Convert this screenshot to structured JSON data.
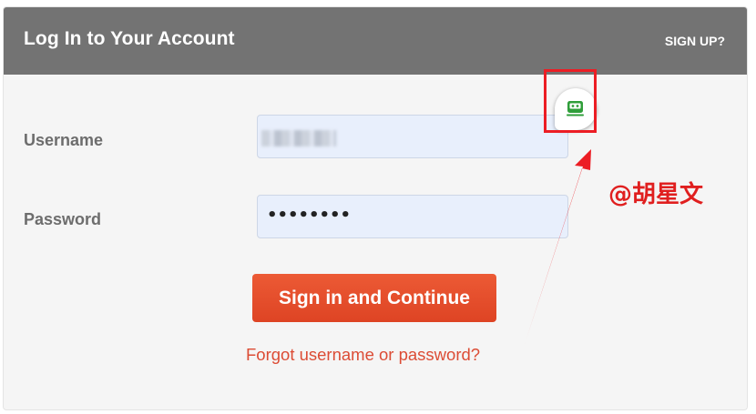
{
  "header": {
    "title": "Log In to Your Account",
    "signup_label": "SIGN UP?"
  },
  "form": {
    "username_label": "Username",
    "password_label": "Password",
    "password_mask": "••••••••",
    "submit_label": "Sign in and Continue",
    "forgot_label": "Forgot username or password?"
  },
  "annotation": {
    "watermark": "@胡星文"
  },
  "colors": {
    "header_bg": "#737373",
    "button_bg": "#e44d2b",
    "link": "#dc4c35",
    "input_bg": "#e8effc",
    "annotation_red": "#ec1d24"
  },
  "extension_icon": "password-manager-icon"
}
